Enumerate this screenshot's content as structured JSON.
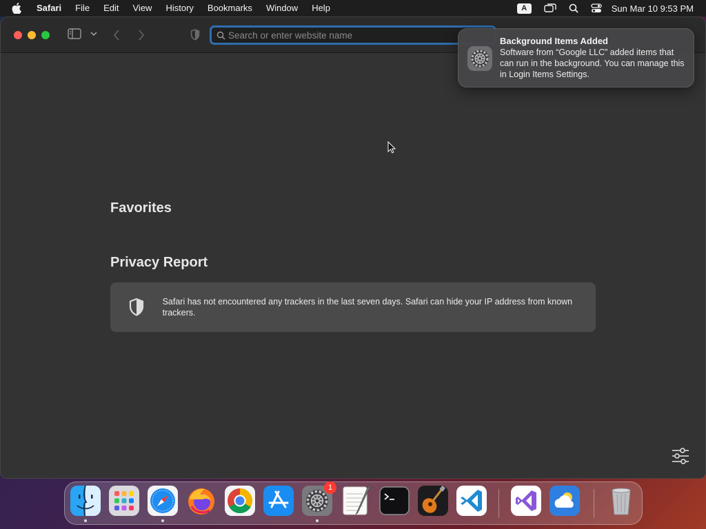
{
  "menubar": {
    "app_name": "Safari",
    "items": [
      "File",
      "Edit",
      "View",
      "History",
      "Bookmarks",
      "Window",
      "Help"
    ],
    "input_source": "A",
    "clock": "Sun Mar 10  9:53 PM"
  },
  "browser": {
    "address_placeholder": "Search or enter website name",
    "address_value": ""
  },
  "start_page": {
    "favorites_title": "Favorites",
    "privacy_title": "Privacy Report",
    "privacy_text": "Safari has not encountered any trackers in the last seven days. Safari can hide your IP address from known trackers."
  },
  "notification": {
    "title": "Background Items Added",
    "message": "Software from “Google LLC” added items that can run in the background. You can manage this in Login Items Settings."
  },
  "dock": {
    "apps": [
      {
        "name": "Finder",
        "running": true
      },
      {
        "name": "Launchpad",
        "running": false
      },
      {
        "name": "Safari",
        "running": true
      },
      {
        "name": "Firefox",
        "running": false
      },
      {
        "name": "Google Chrome",
        "running": false
      },
      {
        "name": "App Store",
        "running": false
      },
      {
        "name": "System Settings",
        "running": true,
        "badge": "1"
      },
      {
        "name": "TextEdit",
        "running": false
      },
      {
        "name": "Terminal",
        "running": false
      },
      {
        "name": "GarageBand",
        "running": false
      },
      {
        "name": "Visual Studio Code",
        "running": false
      },
      {
        "name": "Visual Studio",
        "running": false
      },
      {
        "name": "Weather",
        "running": false
      },
      {
        "name": "Trash",
        "running": false
      }
    ]
  },
  "colors": {
    "accent": "#2f6fb0",
    "window_bg": "#333334",
    "card_bg": "#4a4a4b",
    "badge_red": "#ff3b30"
  }
}
